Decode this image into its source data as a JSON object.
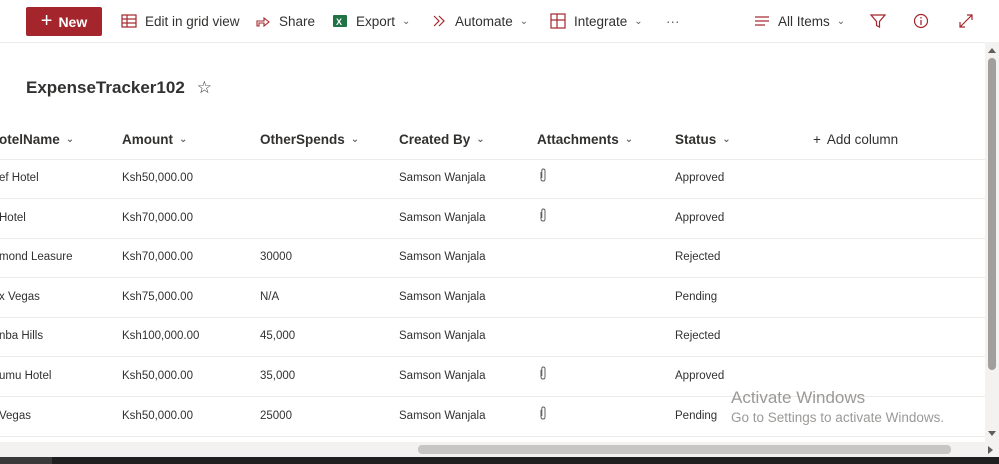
{
  "commandbar": {
    "new_label": "New",
    "edit_grid_label": "Edit in grid view",
    "share_label": "Share",
    "export_label": "Export",
    "automate_label": "Automate",
    "integrate_label": "Integrate",
    "more_label": "···",
    "view_label": "All Items"
  },
  "colors": {
    "accent": "#a4262c",
    "excel_green": "#217346"
  },
  "list": {
    "title": "ExpenseTracker102",
    "favorite_icon": "☆"
  },
  "columns": [
    {
      "label": "otelName",
      "has_chevron": true
    },
    {
      "label": "Amount",
      "has_chevron": true
    },
    {
      "label": "OtherSpends",
      "has_chevron": true
    },
    {
      "label": "Created By",
      "has_chevron": true
    },
    {
      "label": "Attachments",
      "has_chevron": true
    },
    {
      "label": "Status",
      "has_chevron": true
    },
    {
      "label": "Add column",
      "prefix": "+"
    }
  ],
  "rows": [
    {
      "hotel": "ef Hotel",
      "amount": "Ksh50,000.00",
      "other": "",
      "created_by": "Samson Wanjala",
      "attachment": true,
      "status": "Approved"
    },
    {
      "hotel": "Hotel",
      "amount": "Ksh70,000.00",
      "other": "",
      "created_by": "Samson Wanjala",
      "attachment": true,
      "status": "Approved"
    },
    {
      "hotel": "mond Leasure",
      "amount": "Ksh70,000.00",
      "other": "30000",
      "created_by": "Samson Wanjala",
      "attachment": false,
      "status": "Rejected"
    },
    {
      "hotel": "x Vegas",
      "amount": "Ksh75,000.00",
      "other": "N/A",
      "created_by": "Samson Wanjala",
      "attachment": false,
      "status": "Pending"
    },
    {
      "hotel": "nba Hills",
      "amount": "Ksh100,000.00",
      "other": "45,000",
      "created_by": "Samson Wanjala",
      "attachment": false,
      "status": "Rejected"
    },
    {
      "hotel": "umu Hotel",
      "amount": "Ksh50,000.00",
      "other": "35,000",
      "created_by": "Samson Wanjala",
      "attachment": true,
      "status": "Approved"
    },
    {
      "hotel": "Vegas",
      "amount": "Ksh50,000.00",
      "other": "25000",
      "created_by": "Samson Wanjala",
      "attachment": true,
      "status": "Pending"
    }
  ],
  "watermark": {
    "line1": "Activate Windows",
    "line2": "Go to Settings to activate Windows."
  }
}
